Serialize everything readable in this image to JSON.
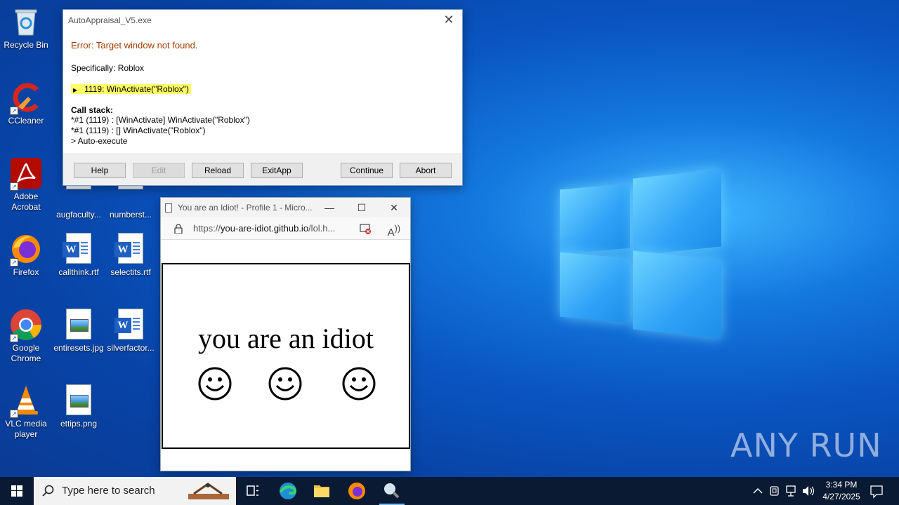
{
  "desktop": {
    "icons": [
      {
        "label": "Recycle Bin",
        "icon": "recycle-bin-icon"
      },
      {
        "label": "CCleaner",
        "icon": "ccleaner-icon"
      },
      {
        "label": "Adobe Acrobat",
        "icon": "adobe-acrobat-icon"
      },
      {
        "label": "Firefox",
        "icon": "firefox-icon"
      },
      {
        "label": "Google Chrome",
        "icon": "chrome-icon"
      },
      {
        "label": "VLC media player",
        "icon": "vlc-icon"
      },
      {
        "label": "augfaculty...",
        "icon": "document-icon"
      },
      {
        "label": "numberst...",
        "icon": "document-icon"
      },
      {
        "label": "callthink.rtf",
        "icon": "word-doc-icon"
      },
      {
        "label": "selectits.rtf",
        "icon": "word-doc-icon"
      },
      {
        "label": "entiresets.jpg",
        "icon": "image-file-icon"
      },
      {
        "label": "silverfactor...",
        "icon": "word-doc-icon"
      },
      {
        "label": "ettips.png",
        "icon": "image-file-icon"
      }
    ]
  },
  "dialog": {
    "title": "AutoAppraisal_V5.exe",
    "error": "Error: Target window not found.",
    "specifically": "Specifically: Roblox",
    "highlight_line": "1119: WinActivate(\"Roblox\")",
    "callstack_title": "Call stack:",
    "callstack": [
      "*#1 (1119) : [WinActivate] WinActivate(\"Roblox\")",
      "*#1 (1119) : [] WinActivate(\"Roblox\")",
      "> Auto-execute"
    ],
    "buttons": {
      "help": "Help",
      "edit": "Edit",
      "reload": "Reload",
      "exitapp": "ExitApp",
      "continue": "Continue",
      "abort": "Abort"
    }
  },
  "browser": {
    "title": "You are an Idiot! - Profile 1 - Micro...",
    "url_prefix": "https://",
    "url_domain": "you-are-idiot.github.io",
    "url_rest": "/lol.h...",
    "page_text": "you are an idiot"
  },
  "taskbar": {
    "search_placeholder": "Type here to search",
    "time": "3:34 PM",
    "date": "4/27/2025"
  },
  "watermark": "ANY RUN"
}
